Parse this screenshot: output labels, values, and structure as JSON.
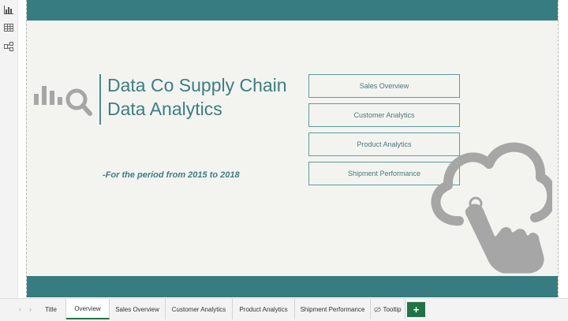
{
  "report": {
    "title_line1": "Data Co Supply Chain",
    "title_line2": "Data Analytics",
    "subtitle": "-For the period from 2015 to 2018",
    "nav_buttons": [
      "Sales Overview",
      "Customer Analytics",
      "Product Analytics",
      "Shipment Performance"
    ]
  },
  "rail": {
    "icons": [
      "report-view-icon",
      "data-view-icon",
      "model-view-icon"
    ]
  },
  "tabs": [
    {
      "label": "Title"
    },
    {
      "label": "Overview",
      "active": true
    },
    {
      "label": "Sales Overview"
    },
    {
      "label": "Customer Analytics"
    },
    {
      "label": "Product Analytics"
    },
    {
      "label": "Shipment Performance"
    },
    {
      "label": "Tooltip",
      "icon": "hidden-page-icon"
    }
  ],
  "add_page_label": "+",
  "colors": {
    "teal": "#367c80",
    "accent_green": "#217346",
    "canvas": "#f3f4f0",
    "icon_gray": "#a6a6a6"
  }
}
